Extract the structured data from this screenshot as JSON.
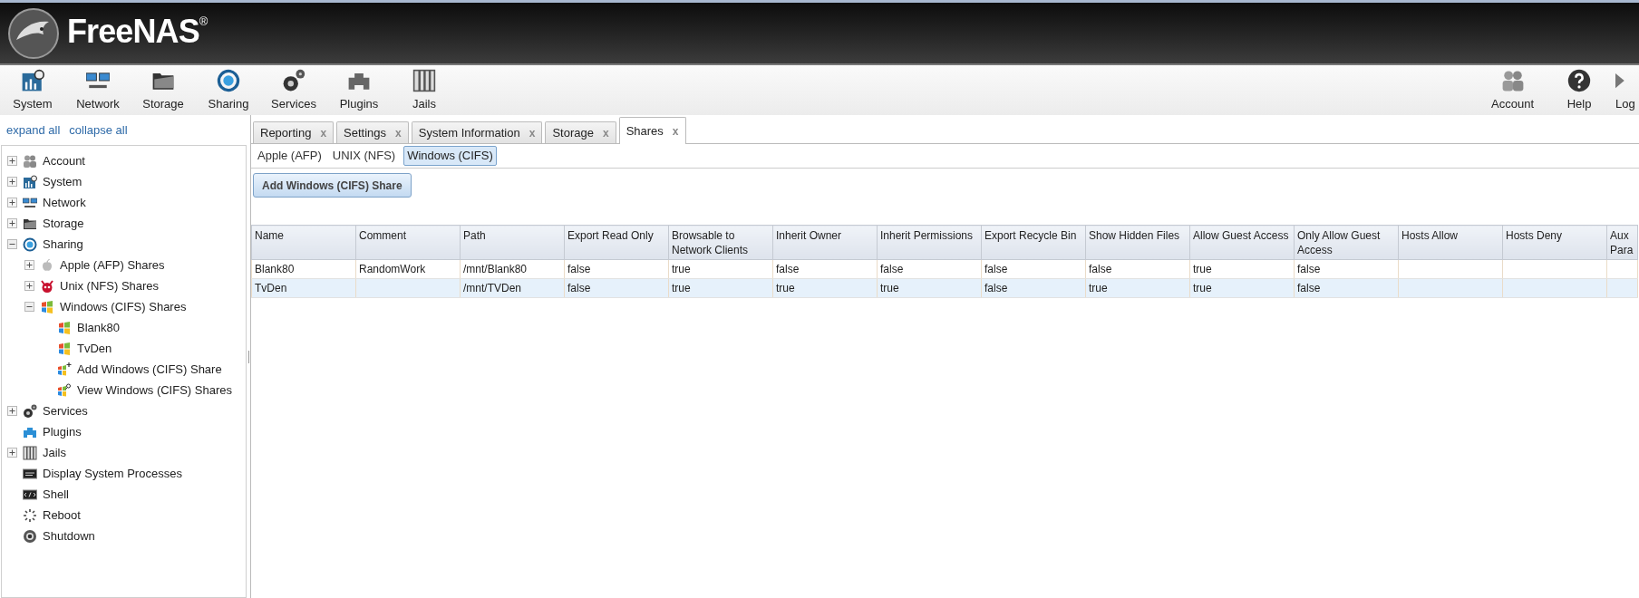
{
  "header": {
    "logo_text": "FreeNAS",
    "registered_mark": "®"
  },
  "toolbar": {
    "left": [
      {
        "label": "System"
      },
      {
        "label": "Network"
      },
      {
        "label": "Storage"
      },
      {
        "label": "Sharing"
      },
      {
        "label": "Services"
      },
      {
        "label": "Plugins"
      },
      {
        "label": "Jails"
      }
    ],
    "right": [
      {
        "label": "Account"
      },
      {
        "label": "Help"
      },
      {
        "label": "Log"
      }
    ]
  },
  "sidebar": {
    "links": [
      "expand all",
      "collapse all"
    ],
    "tree": [
      {
        "label": "Account",
        "expanded": false
      },
      {
        "label": "System",
        "expanded": false
      },
      {
        "label": "Network",
        "expanded": false
      },
      {
        "label": "Storage",
        "expanded": false
      },
      {
        "label": "Sharing",
        "expanded": true,
        "children": [
          {
            "label": "Apple (AFP) Shares",
            "expanded": false
          },
          {
            "label": "Unix (NFS) Shares",
            "expanded": false
          },
          {
            "label": "Windows (CIFS) Shares",
            "expanded": true,
            "children": [
              {
                "label": "Blank80"
              },
              {
                "label": "TvDen"
              },
              {
                "label": "Add Windows (CIFS) Share"
              },
              {
                "label": "View Windows (CIFS) Shares"
              }
            ]
          }
        ]
      },
      {
        "label": "Services",
        "expanded": false
      },
      {
        "label": "Plugins"
      },
      {
        "label": "Jails",
        "expanded": false
      },
      {
        "label": "Display System Processes"
      },
      {
        "label": "Shell"
      },
      {
        "label": "Reboot"
      },
      {
        "label": "Shutdown"
      }
    ]
  },
  "tabs": [
    {
      "label": "Reporting",
      "close": "x",
      "selected": false
    },
    {
      "label": "Settings",
      "close": "x",
      "selected": false
    },
    {
      "label": "System Information",
      "close": "x",
      "selected": false
    },
    {
      "label": "Storage",
      "close": "x",
      "selected": false
    },
    {
      "label": "Shares",
      "close": "x",
      "selected": true
    }
  ],
  "subtabs": [
    {
      "label": "Apple (AFP)",
      "selected": false
    },
    {
      "label": "UNIX (NFS)",
      "selected": false
    },
    {
      "label": "Windows (CIFS)",
      "selected": true
    }
  ],
  "add_button": "Add Windows (CIFS) Share",
  "table": {
    "columns": [
      "Name",
      "Comment",
      "Path",
      "Export Read Only",
      "Browsable to Network Clients",
      "Inherit Owner",
      "Inherit Permissions",
      "Export Recycle Bin",
      "Show Hidden Files",
      "Allow Guest Access",
      "Only Allow Guest Access",
      "Hosts Allow",
      "Hosts Deny",
      "Aux Para"
    ],
    "rows": [
      {
        "selected": false,
        "cells": [
          "Blank80",
          "RandomWork",
          "/mnt/Blank80",
          "false",
          "true",
          "false",
          "false",
          "false",
          "false",
          "true",
          "false",
          "",
          "",
          ""
        ]
      },
      {
        "selected": true,
        "cells": [
          "TvDen",
          "",
          "/mnt/TVDen",
          "false",
          "true",
          "true",
          "true",
          "false",
          "true",
          "true",
          "false",
          "",
          "",
          ""
        ]
      }
    ]
  }
}
